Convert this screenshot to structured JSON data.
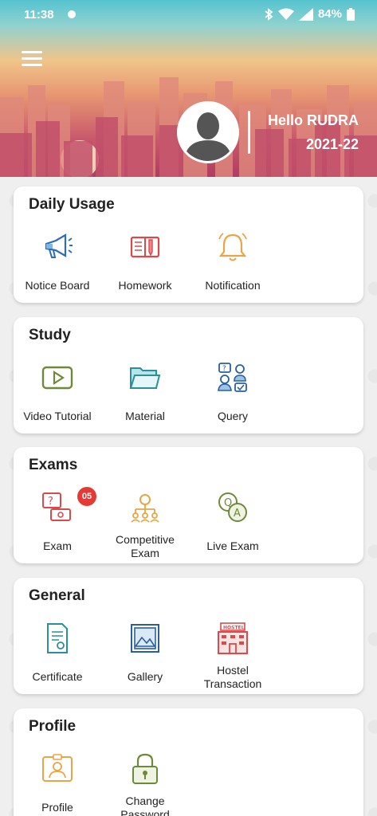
{
  "status_bar": {
    "time": "11:38",
    "battery": "84%"
  },
  "header": {
    "greeting": "Hello RUDRA",
    "session": "2021-22"
  },
  "sections": [
    {
      "title": "Daily Usage",
      "items": [
        {
          "label": "Notice Board",
          "icon": "megaphone-icon"
        },
        {
          "label": "Homework",
          "icon": "book-icon"
        },
        {
          "label": "Notification",
          "icon": "bell-icon"
        }
      ]
    },
    {
      "title": "Study",
      "items": [
        {
          "label": "Video Tutorial",
          "icon": "video-play-icon"
        },
        {
          "label": "Material",
          "icon": "folder-icon"
        },
        {
          "label": "Query",
          "icon": "query-people-icon"
        }
      ]
    },
    {
      "title": "Exams",
      "items": [
        {
          "label": "Exam",
          "icon": "exam-question-icon",
          "badge": "05"
        },
        {
          "label": "Competitive Exam",
          "icon": "competitive-network-icon"
        },
        {
          "label": "Live Exam",
          "icon": "qa-bubbles-icon"
        }
      ]
    },
    {
      "title": "General",
      "items": [
        {
          "label": "Certificate",
          "icon": "certificate-icon"
        },
        {
          "label": "Gallery",
          "icon": "image-frame-icon"
        },
        {
          "label": "Hostel Transaction",
          "icon": "hostel-building-icon",
          "sign": "HOSTEL"
        }
      ]
    },
    {
      "title": "Profile",
      "items": [
        {
          "label": "Profile",
          "icon": "id-card-icon"
        },
        {
          "label": "Change Password",
          "icon": "padlock-icon"
        }
      ]
    }
  ],
  "colors": {
    "header_top": "#55c3cf",
    "header_bottom": "#b03c62",
    "badge": "#e53935"
  }
}
